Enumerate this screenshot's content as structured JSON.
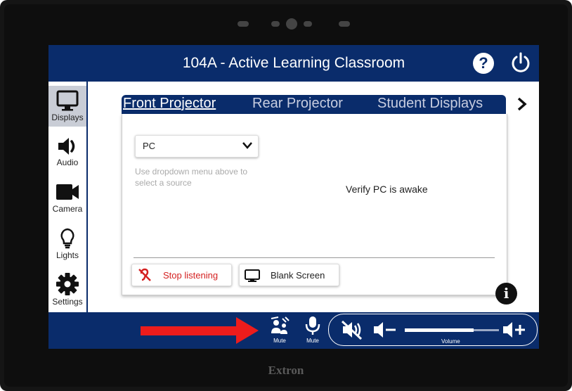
{
  "header": {
    "title": "104A - Active Learning Classroom",
    "help_symbol": "?"
  },
  "sidebar": {
    "items": [
      {
        "label": "Displays",
        "icon": "monitor-icon",
        "active": true
      },
      {
        "label": "Audio",
        "icon": "speaker-icon"
      },
      {
        "label": "Camera",
        "icon": "camera-icon"
      },
      {
        "label": "Lights",
        "icon": "lightbulb-icon"
      },
      {
        "label": "Settings",
        "icon": "gear-icon"
      }
    ]
  },
  "tabs": [
    {
      "label": "Front Projector",
      "active": true
    },
    {
      "label": "Rear Projector"
    },
    {
      "label": "Student Displays"
    }
  ],
  "source": {
    "selected": "PC",
    "hint": "Use dropdown menu above to select a source"
  },
  "status_text": "Verify PC is awake",
  "actions": {
    "stop_listening": "Stop listening",
    "blank_screen": "Blank Screen"
  },
  "info_symbol": "i",
  "footer": {
    "mute_presenter_label": "Mute",
    "mute_mic_label": "Mute",
    "volume_label": "Volume",
    "volume_level": 0.73
  },
  "colors": {
    "navy": "#0a2c6b",
    "stop_red": "#d42020",
    "annotation_arrow": "#ec1c1c"
  },
  "brand": "Extron"
}
